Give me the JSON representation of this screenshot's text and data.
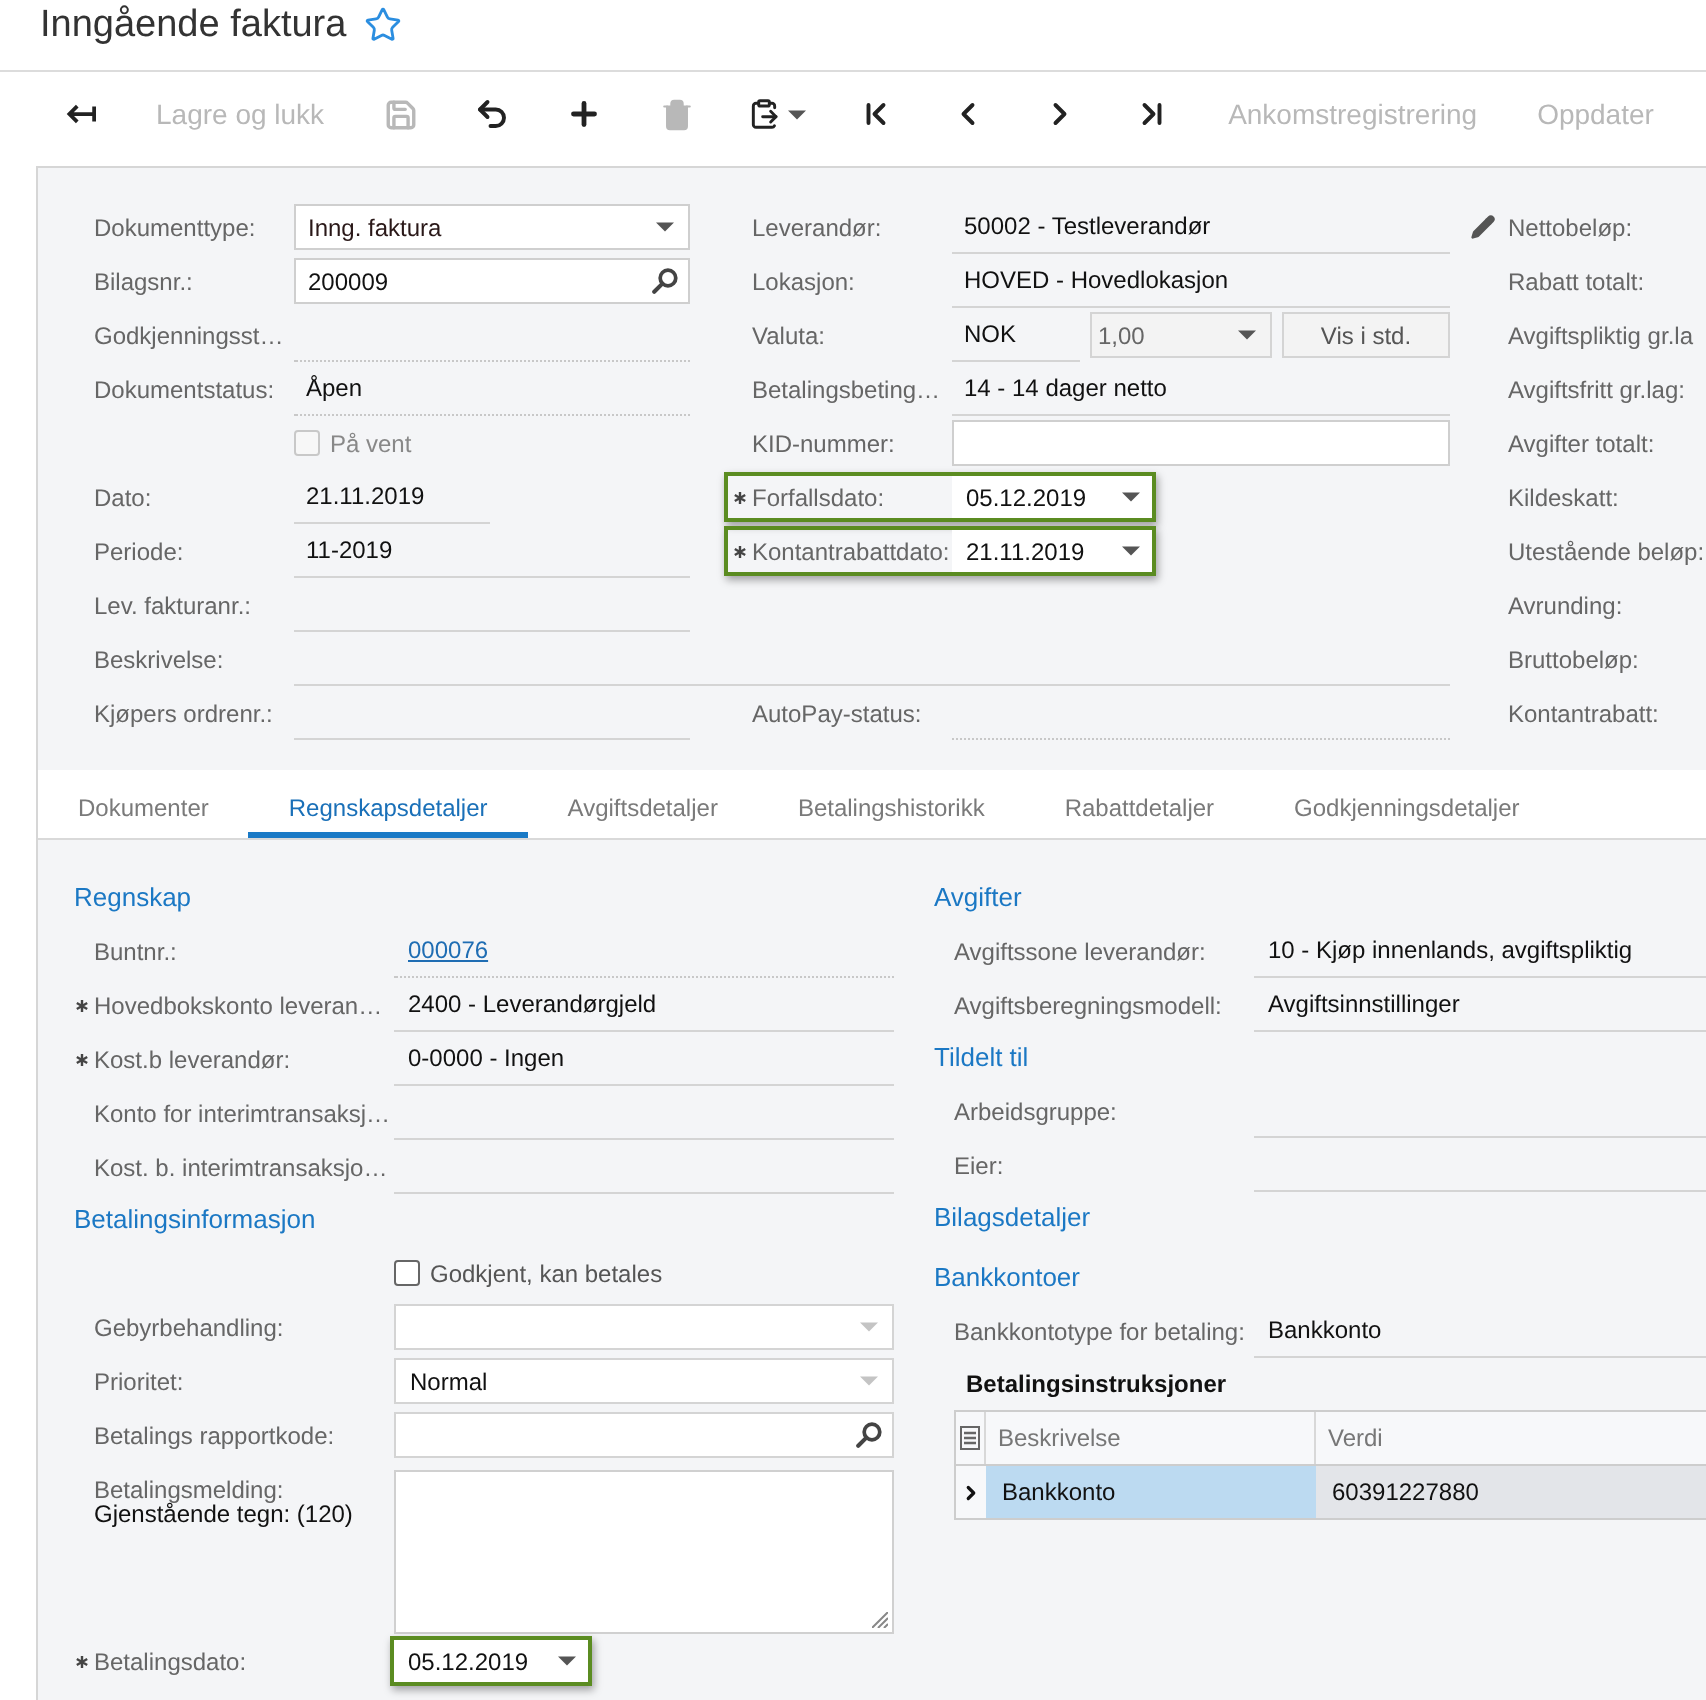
{
  "page": {
    "title": "Inngående faktura",
    "favorite": false
  },
  "toolbar": [
    {
      "kind": "back",
      "disabled": false
    },
    {
      "kind": "text",
      "label": "Lagre og lukk",
      "disabled": true
    },
    {
      "kind": "save",
      "disabled": true
    },
    {
      "kind": "undo",
      "disabled": false
    },
    {
      "kind": "add",
      "disabled": false
    },
    {
      "kind": "delete",
      "disabled": true
    },
    {
      "kind": "paste",
      "disabled": false
    },
    {
      "kind": "first",
      "disabled": false
    },
    {
      "kind": "previous",
      "disabled": false
    },
    {
      "kind": "next",
      "disabled": false
    },
    {
      "kind": "last",
      "disabled": false
    },
    {
      "kind": "text",
      "label": "Ankomstregistrering",
      "disabled": true
    },
    {
      "kind": "text",
      "label": "Oppdater",
      "disabled": true
    }
  ],
  "header": {
    "column_1": [
      {
        "kind": "select",
        "label": "Dokumenttype:",
        "value": "Inng. faktura"
      },
      {
        "kind": "lookup",
        "label": "Bilagsnr.:",
        "value": "200009"
      },
      {
        "kind": "readonly",
        "label": "Godkjenningsst…"
      },
      {
        "kind": "readonly",
        "label": "Dokumentstatus:",
        "value": "Åpen"
      },
      {
        "kind": "checkbox",
        "label": "På vent",
        "checked": false,
        "disabled": true
      },
      {
        "kind": "date",
        "label": "Dato:",
        "value": "21.11.2019"
      },
      {
        "kind": "text",
        "label": "Periode:",
        "value": "11-2019"
      },
      {
        "kind": "text",
        "label": "Lev. fakturanr.:"
      },
      {
        "kind": "wide",
        "label": "Beskrivelse:"
      },
      {
        "kind": "text",
        "label": "Kjøpers ordrenr.:"
      }
    ],
    "column_2": [
      {
        "kind": "text",
        "label": "Leverandør:",
        "value": "50002 - Testleverandør",
        "required": false,
        "highlighted": false
      },
      {
        "kind": "text",
        "label": "Lokasjon:",
        "value": "HOVED - Hovedlokasjon",
        "required": false,
        "highlighted": false
      },
      {
        "kind": "currency",
        "label": "Valuta:",
        "value": "NOK",
        "rate": "1,00",
        "button": "Vis i std.",
        "required": false,
        "highlighted": false
      },
      {
        "kind": "text",
        "label": "Betalingsbeting…",
        "value": "14 - 14 dager netto",
        "required": false,
        "highlighted": false
      },
      {
        "kind": "input",
        "label": "KID-nummer:",
        "required": false,
        "highlighted": false
      },
      {
        "kind": "datepicker",
        "label": "Forfallsdato:",
        "value": "05.12.2019",
        "required": true,
        "highlighted": true
      },
      {
        "kind": "datepicker",
        "label": "Kontantrabattdato:",
        "value": "21.11.2019",
        "required": true,
        "highlighted": true
      },
      {
        "kind": "readonly",
        "label": "AutoPay-status:",
        "required": false,
        "highlighted": false
      }
    ],
    "totals": [
      {
        "label": "Nettobeløp:",
        "editable": true
      },
      {
        "label": "Rabatt totalt:",
        "editable": false
      },
      {
        "label": "Avgiftspliktig gr.la",
        "editable": false
      },
      {
        "label": "Avgiftsfritt gr.lag:",
        "editable": false
      },
      {
        "label": "Avgifter totalt:",
        "editable": false
      },
      {
        "label": "Kildeskatt:",
        "editable": false
      },
      {
        "label": "Utestående beløp:",
        "editable": false
      },
      {
        "label": "Avrunding:",
        "editable": false
      },
      {
        "label": "Bruttobeløp:",
        "editable": false
      },
      {
        "label": "Kontantrabatt:",
        "editable": false
      }
    ]
  },
  "tabs": [
    {
      "label": "Dokumenter",
      "selected": false
    },
    {
      "label": "Regnskapsdetaljer",
      "selected": true
    },
    {
      "label": "Avgiftsdetaljer",
      "selected": false
    },
    {
      "label": "Betalingshistorikk",
      "selected": false
    },
    {
      "label": "Rabattdetaljer",
      "selected": false
    },
    {
      "label": "Godkjenningsdetaljer",
      "selected": false
    }
  ],
  "details": {
    "left": [
      {
        "heading": "Regnskap",
        "fields": [
          {
            "kind": "link",
            "label": "Buntnr.:",
            "value": "000076",
            "required": false
          },
          {
            "kind": "text",
            "label": "Hovedbokskonto leveran…",
            "value": "2400 - Leverandørgjeld",
            "required": true
          },
          {
            "kind": "text",
            "label": "Kost.b leverandør:",
            "value": "0-0000 - Ingen",
            "required": true
          },
          {
            "kind": "text",
            "label": "Konto for interimtransaksj…",
            "required": false
          },
          {
            "kind": "text",
            "label": "Kost. b. interimtransaksjo…",
            "required": false
          }
        ]
      },
      {
        "heading": "Betalingsinformasjon",
        "fields": [
          {
            "kind": "checkbox",
            "label": "Godkjent, kan betales",
            "checked": false,
            "disabled": false,
            "required": false,
            "highlighted": false
          },
          {
            "kind": "select",
            "label": "Gebyrbehandling:",
            "required": false,
            "highlighted": false
          },
          {
            "kind": "select",
            "label": "Prioritet:",
            "value": "Normal",
            "required": false,
            "highlighted": false
          },
          {
            "kind": "lookup",
            "label": "Betalings rapportkode:",
            "required": false,
            "highlighted": false
          },
          {
            "kind": "textarea",
            "label": "Betalingsmelding:",
            "note": "Gjenstående tegn: (120)",
            "required": false,
            "highlighted": false
          },
          {
            "kind": "datepicker",
            "label": "Betalingsdato:",
            "value": "05.12.2019",
            "required": true,
            "highlighted": true
          }
        ]
      }
    ],
    "right": [
      {
        "heading": "Avgifter",
        "fields": [
          {
            "kind": "text",
            "label": "Avgiftssone leverandør:",
            "value": "10 - Kjøp innenlands, avgiftspliktig"
          },
          {
            "kind": "text",
            "label": "Avgiftsberegningsmodell:",
            "value": "Avgiftsinnstillinger"
          }
        ]
      },
      {
        "heading": "Tildelt til",
        "fields": [
          {
            "kind": "text",
            "label": "Arbeidsgruppe:"
          },
          {
            "kind": "text",
            "label": "Eier:"
          }
        ]
      },
      {
        "heading": "Bilagsdetaljer"
      },
      {
        "heading": "Bankkontoer",
        "fields": [
          {
            "kind": "text",
            "label": "Bankkontotype for betaling:",
            "value": "Bankkonto"
          }
        ],
        "grid": {
          "title": "Betalingsinstruksjoner",
          "columns": [
            "Beskrivelse",
            "Verdi"
          ],
          "rows": [
            {
              "cells": [
                "Bankkonto",
                "60391227880"
              ],
              "selected": true
            }
          ]
        }
      }
    ]
  }
}
